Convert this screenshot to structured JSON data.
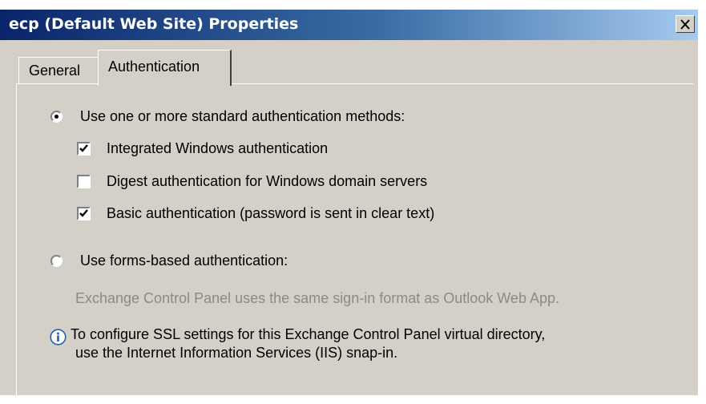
{
  "window": {
    "title": "ecp (Default Web Site) Properties",
    "close_glyph": "X"
  },
  "tabs": [
    {
      "label": "General",
      "selected": false
    },
    {
      "label": "Authentication",
      "selected": true
    }
  ],
  "auth": {
    "standard_option": {
      "label": "Use one or more standard authentication methods:",
      "selected": true
    },
    "methods": [
      {
        "label": "Integrated Windows authentication",
        "checked": true
      },
      {
        "label": "Digest authentication for Windows domain servers",
        "checked": false
      },
      {
        "label": "Basic authentication (password is sent in clear text)",
        "checked": true
      }
    ],
    "forms_option": {
      "label": "Use forms-based authentication:",
      "selected": false
    },
    "forms_note": "Exchange Control Panel uses the same sign-in format as Outlook Web App.",
    "info_line1": "To configure SSL settings for this Exchange Control Panel virtual directory,",
    "info_line2": "use the Internet Information Services (IIS) snap-in.",
    "info_icon": "info-icon"
  },
  "colors": {
    "face": "#d4d0c8",
    "title_start": "#0a246a",
    "title_end": "#a6caf0",
    "disabled_text": "#8a8a8a"
  }
}
